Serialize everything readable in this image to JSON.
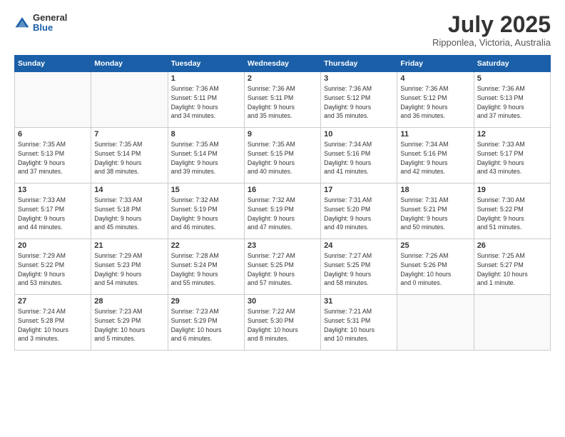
{
  "header": {
    "logo_general": "General",
    "logo_blue": "Blue",
    "month_year": "July 2025",
    "location": "Ripponlea, Victoria, Australia"
  },
  "calendar": {
    "days_of_week": [
      "Sunday",
      "Monday",
      "Tuesday",
      "Wednesday",
      "Thursday",
      "Friday",
      "Saturday"
    ],
    "weeks": [
      [
        {
          "day": null,
          "info": null
        },
        {
          "day": null,
          "info": null
        },
        {
          "day": "1",
          "info": "Sunrise: 7:36 AM\nSunset: 5:11 PM\nDaylight: 9 hours\nand 34 minutes."
        },
        {
          "day": "2",
          "info": "Sunrise: 7:36 AM\nSunset: 5:11 PM\nDaylight: 9 hours\nand 35 minutes."
        },
        {
          "day": "3",
          "info": "Sunrise: 7:36 AM\nSunset: 5:12 PM\nDaylight: 9 hours\nand 35 minutes."
        },
        {
          "day": "4",
          "info": "Sunrise: 7:36 AM\nSunset: 5:12 PM\nDaylight: 9 hours\nand 36 minutes."
        },
        {
          "day": "5",
          "info": "Sunrise: 7:36 AM\nSunset: 5:13 PM\nDaylight: 9 hours\nand 37 minutes."
        }
      ],
      [
        {
          "day": "6",
          "info": "Sunrise: 7:35 AM\nSunset: 5:13 PM\nDaylight: 9 hours\nand 37 minutes."
        },
        {
          "day": "7",
          "info": "Sunrise: 7:35 AM\nSunset: 5:14 PM\nDaylight: 9 hours\nand 38 minutes."
        },
        {
          "day": "8",
          "info": "Sunrise: 7:35 AM\nSunset: 5:14 PM\nDaylight: 9 hours\nand 39 minutes."
        },
        {
          "day": "9",
          "info": "Sunrise: 7:35 AM\nSunset: 5:15 PM\nDaylight: 9 hours\nand 40 minutes."
        },
        {
          "day": "10",
          "info": "Sunrise: 7:34 AM\nSunset: 5:16 PM\nDaylight: 9 hours\nand 41 minutes."
        },
        {
          "day": "11",
          "info": "Sunrise: 7:34 AM\nSunset: 5:16 PM\nDaylight: 9 hours\nand 42 minutes."
        },
        {
          "day": "12",
          "info": "Sunrise: 7:33 AM\nSunset: 5:17 PM\nDaylight: 9 hours\nand 43 minutes."
        }
      ],
      [
        {
          "day": "13",
          "info": "Sunrise: 7:33 AM\nSunset: 5:17 PM\nDaylight: 9 hours\nand 44 minutes."
        },
        {
          "day": "14",
          "info": "Sunrise: 7:33 AM\nSunset: 5:18 PM\nDaylight: 9 hours\nand 45 minutes."
        },
        {
          "day": "15",
          "info": "Sunrise: 7:32 AM\nSunset: 5:19 PM\nDaylight: 9 hours\nand 46 minutes."
        },
        {
          "day": "16",
          "info": "Sunrise: 7:32 AM\nSunset: 5:19 PM\nDaylight: 9 hours\nand 47 minutes."
        },
        {
          "day": "17",
          "info": "Sunrise: 7:31 AM\nSunset: 5:20 PM\nDaylight: 9 hours\nand 49 minutes."
        },
        {
          "day": "18",
          "info": "Sunrise: 7:31 AM\nSunset: 5:21 PM\nDaylight: 9 hours\nand 50 minutes."
        },
        {
          "day": "19",
          "info": "Sunrise: 7:30 AM\nSunset: 5:22 PM\nDaylight: 9 hours\nand 51 minutes."
        }
      ],
      [
        {
          "day": "20",
          "info": "Sunrise: 7:29 AM\nSunset: 5:22 PM\nDaylight: 9 hours\nand 53 minutes."
        },
        {
          "day": "21",
          "info": "Sunrise: 7:29 AM\nSunset: 5:23 PM\nDaylight: 9 hours\nand 54 minutes."
        },
        {
          "day": "22",
          "info": "Sunrise: 7:28 AM\nSunset: 5:24 PM\nDaylight: 9 hours\nand 55 minutes."
        },
        {
          "day": "23",
          "info": "Sunrise: 7:27 AM\nSunset: 5:25 PM\nDaylight: 9 hours\nand 57 minutes."
        },
        {
          "day": "24",
          "info": "Sunrise: 7:27 AM\nSunset: 5:25 PM\nDaylight: 9 hours\nand 58 minutes."
        },
        {
          "day": "25",
          "info": "Sunrise: 7:26 AM\nSunset: 5:26 PM\nDaylight: 10 hours\nand 0 minutes."
        },
        {
          "day": "26",
          "info": "Sunrise: 7:25 AM\nSunset: 5:27 PM\nDaylight: 10 hours\nand 1 minute."
        }
      ],
      [
        {
          "day": "27",
          "info": "Sunrise: 7:24 AM\nSunset: 5:28 PM\nDaylight: 10 hours\nand 3 minutes."
        },
        {
          "day": "28",
          "info": "Sunrise: 7:23 AM\nSunset: 5:29 PM\nDaylight: 10 hours\nand 5 minutes."
        },
        {
          "day": "29",
          "info": "Sunrise: 7:23 AM\nSunset: 5:29 PM\nDaylight: 10 hours\nand 6 minutes."
        },
        {
          "day": "30",
          "info": "Sunrise: 7:22 AM\nSunset: 5:30 PM\nDaylight: 10 hours\nand 8 minutes."
        },
        {
          "day": "31",
          "info": "Sunrise: 7:21 AM\nSunset: 5:31 PM\nDaylight: 10 hours\nand 10 minutes."
        },
        {
          "day": null,
          "info": null
        },
        {
          "day": null,
          "info": null
        }
      ]
    ]
  }
}
